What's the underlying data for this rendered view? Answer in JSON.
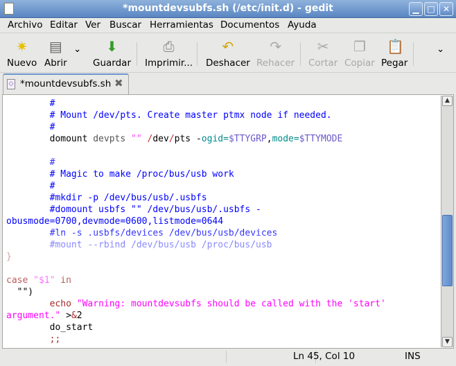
{
  "window": {
    "title": "*mountdevsubfs.sh (/etc/init.d) - gedit",
    "minimize": "▁",
    "maximize": "□",
    "close": "✕"
  },
  "menu": [
    "Archivo",
    "Editar",
    "Ver",
    "Buscar",
    "Herramientas",
    "Documentos",
    "Ayuda"
  ],
  "toolbar": {
    "new": "Nuevo",
    "open": "Abrir",
    "save": "Guardar",
    "print": "Imprimir...",
    "undo": "Deshacer",
    "redo": "Rehacer",
    "cut": "Cortar",
    "copy": "Copiar",
    "paste": "Pegar",
    "more": "⌄"
  },
  "tab": {
    "label": "*mountdevsubfs.sh",
    "close": "✖"
  },
  "colors": {
    "comment": "#0000ff",
    "keyword": "#a52a2a",
    "string": "#ff00ff",
    "variable": "#6a5acd",
    "option": "#008b8b",
    "accent": "#5d8acb"
  },
  "code": [
    [
      [
        "        #",
        "#0000ff"
      ]
    ],
    [
      [
        "        # Mount /dev/pts. Create master ptmx node if needed.",
        "#0000ff"
      ]
    ],
    [
      [
        "        #",
        "#0000ff"
      ]
    ],
    [
      [
        "        domount ",
        "#000"
      ],
      [
        "devpts ",
        "#555"
      ],
      [
        "\"\" ",
        "#ff40ff"
      ],
      [
        "/",
        "#c03030"
      ],
      [
        "dev",
        "#000"
      ],
      [
        "/",
        "#c03030"
      ],
      [
        "pts -",
        "#000"
      ],
      [
        "ogid=",
        "#008b8b"
      ],
      [
        "$TTYGRP",
        "#6a5acd"
      ],
      [
        ",",
        "#000"
      ],
      [
        "mode=",
        "#008b8b"
      ],
      [
        "$TTYMODE",
        "#6a5acd"
      ]
    ],
    [
      [
        "",
        ""
      ]
    ],
    [
      [
        "        #",
        "#3333ff"
      ]
    ],
    [
      [
        "        # Magic to make /proc/bus/usb work",
        "#0000ff"
      ]
    ],
    [
      [
        "        #",
        "#0000ff"
      ]
    ],
    [
      [
        "        #mkdir -p /dev/bus/usb/.usbfs",
        "#0000ff"
      ]
    ],
    [
      [
        "        #domount usbfs \"\" /dev/bus/usb/.usbfs -",
        "#0000ff"
      ]
    ],
    [
      [
        "obusmode=0700,devmode=0600,listmode=0644",
        "#0000ff"
      ]
    ],
    [
      [
        "        #ln -s .usbfs/devices /dev/bus/usb/devices",
        "#0000ff"
      ]
    ],
    [
      [
        "        #mount --rbind /dev/bus/usb /proc/bus/usb",
        "#0000ff"
      ]
    ],
    [
      [
        "}",
        "#a52a2a"
      ]
    ],
    [
      [
        "",
        ""
      ]
    ],
    [
      [
        "case ",
        "#a52a2a"
      ],
      [
        "\"$1\" ",
        "#ff40ff"
      ],
      [
        "in",
        "#a52a2a"
      ]
    ],
    [
      [
        "  \"\")",
        "#000"
      ]
    ],
    [
      [
        "        ",
        "#000"
      ],
      [
        "echo ",
        "#a52a2a"
      ],
      [
        "\"Warning: mountdevsubfs should be called with the 'start'",
        "#ff00ff"
      ]
    ],
    [
      [
        "argument.\"",
        "#ff00ff"
      ],
      [
        " >",
        "#000"
      ],
      [
        "&",
        "#a52a2a"
      ],
      [
        "2",
        "#000"
      ]
    ],
    [
      [
        "        do_start",
        "#000"
      ]
    ],
    [
      [
        "        ;;",
        "#a52a2a"
      ]
    ]
  ],
  "status": {
    "position": "Ln 45, Col 10",
    "mode": "INS"
  },
  "scroll": {
    "position_fraction": 0.55
  }
}
